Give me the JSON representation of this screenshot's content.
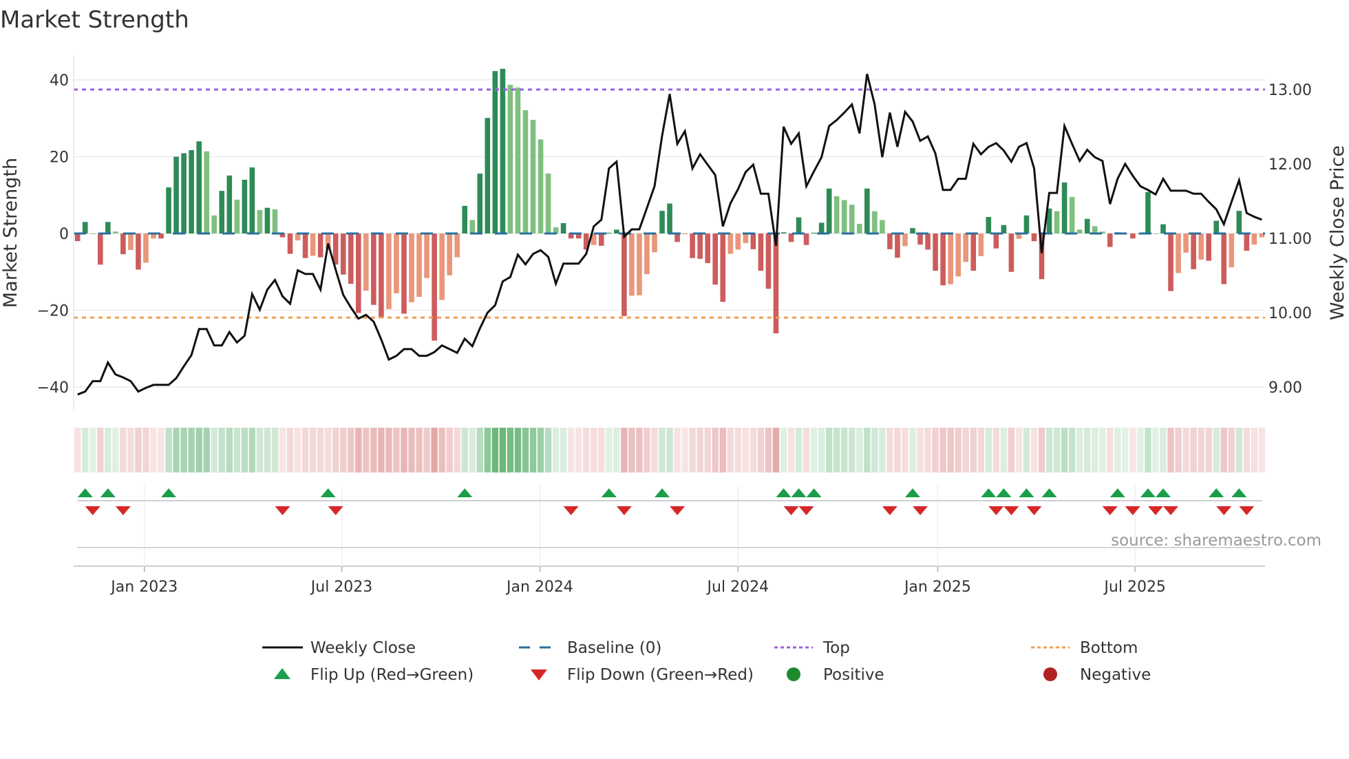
{
  "chart_data": {
    "type": "bar",
    "title": "Market Strength",
    "ylabel": "Market Strength",
    "y2label": "Weekly Close Price",
    "ylim": [
      -42,
      45
    ],
    "y_ticks": [
      40,
      20,
      0,
      -20,
      -40
    ],
    "y_tick_labels": [
      "40",
      "20",
      "0",
      "−20",
      "−40"
    ],
    "y2_ticks": [
      13,
      12,
      11,
      10,
      9
    ],
    "y2_tick_labels": [
      "13.00",
      "12.00",
      "11.00",
      "10.00",
      "9.00"
    ],
    "x_unit": "week index",
    "x_ticks": [
      8.8,
      34.8,
      60.9,
      87.0,
      113.3,
      139.3
    ],
    "x_tick_labels": [
      "Jan 2023",
      "Jul 2023",
      "Jan 2024",
      "Jul 2024",
      "Jan 2025",
      "Jul 2025"
    ],
    "top_level": 37.5,
    "bottom_level": -21.9,
    "baseline": 0,
    "grid": true,
    "strength": [
      -2,
      3,
      0,
      -8.1,
      3,
      0.5,
      -5.4,
      -4.3,
      -9.4,
      -7.6,
      -1.3,
      -1.3,
      12,
      20,
      20.9,
      21.7,
      24,
      21.4,
      4.7,
      11.1,
      15.1,
      8.8,
      14,
      17.2,
      6.1,
      6.7,
      6.3,
      -1,
      -5.3,
      -1.8,
      -6.4,
      -5.8,
      -6.2,
      -4,
      -8.1,
      -10.7,
      -13.1,
      -20.7,
      -14.9,
      -18.6,
      -21.9,
      -19.7,
      -15.6,
      -20.9,
      -17.9,
      -16.5,
      -11.6,
      -27.9,
      -17.3,
      -10.9,
      -6.2,
      7.2,
      3.5,
      15.6,
      30.1,
      42.3,
      42.9,
      38.7,
      38,
      32.1,
      29.6,
      24.5,
      15.6,
      1.6,
      2.7,
      -1.3,
      -1.3,
      -4.2,
      -3,
      -3.2,
      0.2,
      1,
      -21.5,
      -16.2,
      -16.1,
      -10.6,
      -4.9,
      5.9,
      7.8,
      -2.2,
      -0.2,
      -6.4,
      -6.6,
      -7.7,
      -13.3,
      -17.8,
      -5.3,
      -4.2,
      -2.5,
      -4.1,
      -9.7,
      -14.4,
      -26,
      0.3,
      -2.2,
      4.2,
      -3,
      0.2,
      2.8,
      11.7,
      9.7,
      8.7,
      7.5,
      2.5,
      11.7,
      5.8,
      3.5,
      -4.1,
      -6.3,
      -3.3,
      1.4,
      -2.9,
      -4.2,
      -9.7,
      -13.5,
      -13.2,
      -11.2,
      -7.4,
      -9.7,
      -5.9,
      4.3,
      -3.9,
      2.2,
      -10,
      -1.4,
      4.7,
      -2,
      -11.9,
      6.5,
      5.8,
      13.3,
      9.5,
      1,
      3.8,
      1.9,
      0.5,
      -3.5,
      0.3,
      0,
      -1.3,
      0,
      10.8,
      0,
      2.4,
      -15,
      -10.3,
      -5,
      -9.3,
      -6.8,
      -7.1,
      3.3,
      -13.2,
      -8.8,
      5.9,
      -4.5,
      -2.9,
      -1
    ],
    "close": [
      8.9,
      8.94,
      9.08,
      9.08,
      9.33,
      9.17,
      9.13,
      9.08,
      8.94,
      8.99,
      9.03,
      9.03,
      9.03,
      9.12,
      9.28,
      9.43,
      9.78,
      9.78,
      9.56,
      9.56,
      9.74,
      9.6,
      9.69,
      10.25,
      10.04,
      10.31,
      10.44,
      10.22,
      10.12,
      10.57,
      10.52,
      10.52,
      10.31,
      10.93,
      10.58,
      10.24,
      10.07,
      9.92,
      9.97,
      9.88,
      9.64,
      9.37,
      9.42,
      9.51,
      9.51,
      9.42,
      9.42,
      9.47,
      9.56,
      9.51,
      9.46,
      9.65,
      9.55,
      9.79,
      10.0,
      10.1,
      10.42,
      10.48,
      10.78,
      10.65,
      10.79,
      10.84,
      10.75,
      10.39,
      10.66,
      10.66,
      10.66,
      10.79,
      11.16,
      11.25,
      11.94,
      12.03,
      11.02,
      11.12,
      11.12,
      11.41,
      11.7,
      12.38,
      12.94,
      12.27,
      12.44,
      11.94,
      12.13,
      11.99,
      11.85,
      11.16,
      11.47,
      11.66,
      11.89,
      11.99,
      11.6,
      11.6,
      10.9,
      12.5,
      12.27,
      12.41,
      11.7,
      11.9,
      12.09,
      12.51,
      12.59,
      12.69,
      12.8,
      12.41,
      13.21,
      12.8,
      12.09,
      12.69,
      12.23,
      12.7,
      12.57,
      12.31,
      12.37,
      12.14,
      11.65,
      11.65,
      11.8,
      11.8,
      12.27,
      12.13,
      12.23,
      12.28,
      12.18,
      12.03,
      12.23,
      12.28,
      11.94,
      10.8,
      11.61,
      11.61,
      12.51,
      12.27,
      12.04,
      12.19,
      12.09,
      12.04,
      11.46,
      11.8,
      12.0,
      11.84,
      11.7,
      11.65,
      11.59,
      11.8,
      11.64,
      11.64,
      11.64,
      11.6,
      11.6,
      11.49,
      11.39,
      11.19,
      11.49,
      11.78,
      11.34,
      11.29,
      11.25
    ],
    "flip_up_weeks": [
      1,
      4,
      12,
      33,
      51,
      70,
      77,
      93,
      95,
      97,
      110,
      120,
      122,
      125,
      128,
      137,
      141,
      143,
      150,
      153
    ],
    "flip_down_weeks": [
      2,
      6,
      27,
      34,
      65,
      72,
      79,
      94,
      96,
      107,
      111,
      121,
      123,
      126,
      136,
      139,
      142,
      144,
      151,
      154
    ],
    "legend": [
      {
        "label": "Weekly Close",
        "symbol": "line"
      },
      {
        "label": "Baseline (0)",
        "symbol": "dash"
      },
      {
        "label": "Top",
        "symbol": "dot-purple"
      },
      {
        "label": "Bottom",
        "symbol": "dot-orange"
      },
      {
        "label": "Flip Up (Red→Green)",
        "symbol": "triangle-up"
      },
      {
        "label": "Flip Down (Green→Red)",
        "symbol": "triangle-down"
      },
      {
        "label": "Positive",
        "symbol": "circle-green"
      },
      {
        "label": "Negative",
        "symbol": "circle-red"
      }
    ],
    "legend_position": "bottom-center",
    "source": "source: sharemaestro.com",
    "colors": {
      "pos_rising": "#2e8b57",
      "pos_falling": "#7fbf7f",
      "neg_falling": "#cd5c5c",
      "neg_rising": "#e9967a",
      "close": "#111111",
      "baseline": "#2a6f9b",
      "top": "#9b5fe0",
      "bottom": "#f0a050",
      "flip_up": "#1a9e4a",
      "flip_down": "#d62728",
      "positive": "#1e8a2e",
      "negative": "#b22222"
    }
  }
}
